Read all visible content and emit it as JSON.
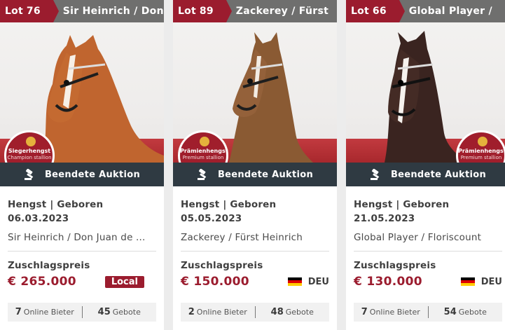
{
  "cards": [
    {
      "lot": "Lot 76",
      "title": "Sir Heinrich / Don",
      "seal_line1": "Siegerhengst",
      "seal_line2": "Champion stallion",
      "status": "Beendete Auktion",
      "meta": "Hengst | Geboren",
      "birth_date": "06.03.2023",
      "pedigree": "Sir Heinrich / Don Juan de ...",
      "price_label": "Zuschlagspreis",
      "price": "€ 265.000",
      "buyer": "Local",
      "bidders_count": "7",
      "bidders_label": "Online Bieter",
      "bids_count": "45",
      "bids_label": "Gebote",
      "horse_color": "#c0652f"
    },
    {
      "lot": "Lot 89",
      "title": "Zackerey / Fürst",
      "seal_line1": "Prämienhengst",
      "seal_line2": "Premium stallion",
      "status": "Beendete Auktion",
      "meta": "Hengst | Geboren",
      "birth_date": "05.05.2023",
      "pedigree": "Zackerey / Fürst Heinrich",
      "price_label": "Zuschlagspreis",
      "price": "€ 150.000",
      "country": "DEU",
      "bidders_count": "2",
      "bidders_label": "Online Bieter",
      "bids_count": "48",
      "bids_label": "Gebote",
      "horse_color": "#8a5a33"
    },
    {
      "lot": "Lot 66",
      "title": "Global Player /",
      "seal_line1": "Prämienhengst",
      "seal_line2": "Premium stallion",
      "status": "Beendete Auktion",
      "meta": "Hengst | Geboren",
      "birth_date": "21.05.2023",
      "pedigree": "Global Player / Floriscount",
      "price_label": "Zuschlagspreis",
      "price": "€ 130.000",
      "country": "DEU",
      "bidders_count": "7",
      "bidders_label": "Online Bieter",
      "bids_count": "54",
      "bids_label": "Gebote",
      "horse_color": "#3a2420"
    }
  ],
  "colors": {
    "accent": "#9b1c2e",
    "status_bar": "#2f3a42"
  }
}
